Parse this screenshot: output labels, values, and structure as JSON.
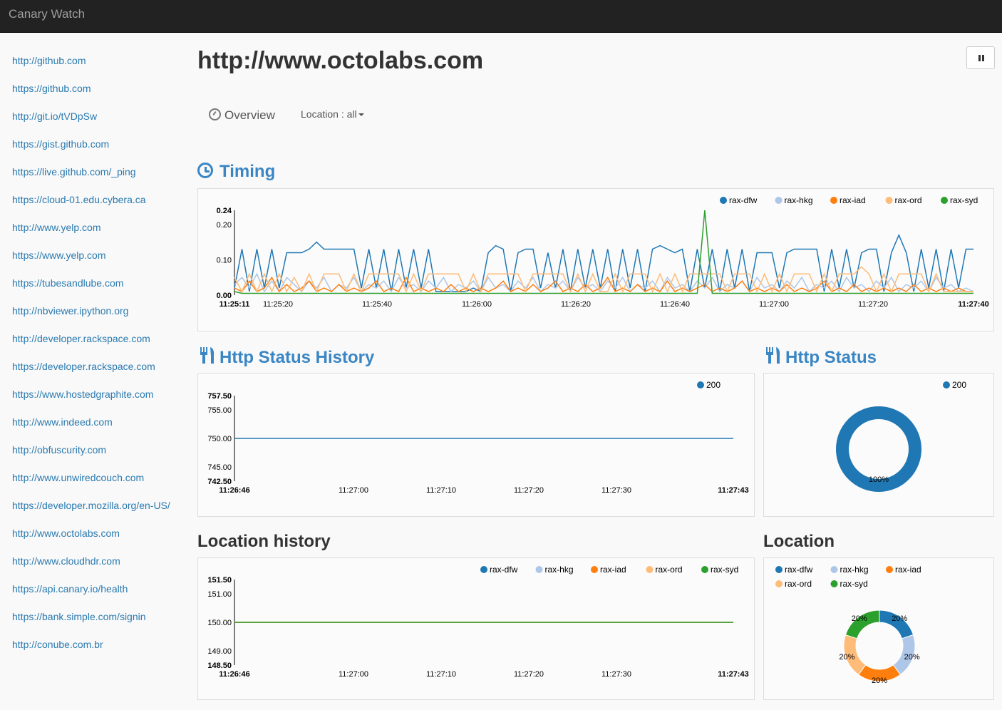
{
  "app": {
    "brand": "Canary Watch"
  },
  "sidebar": {
    "links": [
      "http://github.com",
      "https://github.com",
      "http://git.io/tVDpSw",
      "https://gist.github.com",
      "https://live.github.com/_ping",
      "https://cloud-01.edu.cybera.ca",
      "http://www.yelp.com",
      "https://www.yelp.com",
      "https://tubesandlube.com",
      "http://nbviewer.ipython.org",
      "http://developer.rackspace.com",
      "https://developer.rackspace.com",
      "https://www.hostedgraphite.com",
      "http://www.indeed.com",
      "http://obfuscurity.com",
      "http://www.unwiredcouch.com",
      "https://developer.mozilla.org/en-US/",
      "http://www.octolabs.com",
      "http://www.cloudhdr.com",
      "https://api.canary.io/health",
      "https://bank.simple.com/signin",
      "http://conube.com.br"
    ]
  },
  "page": {
    "title": "http://www.octolabs.com"
  },
  "tabs": {
    "overview": "Overview",
    "location": "Location : all"
  },
  "icons": {
    "pause": "pause-icon",
    "overview": "dashboard-icon",
    "timing": "clock-icon",
    "http": "cutlery-icon"
  },
  "sections": {
    "timing": "Timing",
    "http_status_history": "Http Status History",
    "http_status": "Http Status",
    "location_history": "Location history",
    "location": "Location"
  },
  "colors": {
    "rax-dfw": "#1f77b4",
    "rax-hkg": "#aec7e8",
    "rax-iad": "#ff7f0e",
    "rax-ord": "#ffbb78",
    "rax-syd": "#2ca02c",
    "accent": "#3a86c4"
  },
  "chart_data": [
    {
      "type": "line",
      "title": "Timing",
      "ylim": [
        0,
        0.24
      ],
      "yticks": [
        "0.00",
        "0.10",
        "0.20",
        "0.24"
      ],
      "xticks": [
        "11:25:11",
        "11:25:20",
        "11:25:40",
        "11:26:00",
        "11:26:20",
        "11:26:40",
        "11:27:00",
        "11:27:20",
        "11:27:40"
      ],
      "legend": [
        "rax-dfw",
        "rax-hkg",
        "rax-iad",
        "rax-ord",
        "rax-syd"
      ],
      "legend_position": "top-right",
      "series": [
        {
          "name": "rax-dfw",
          "y": [
            0.02,
            0.13,
            0.01,
            0.13,
            0.02,
            0.13,
            0.02,
            0.12,
            0.12,
            0.12,
            0.13,
            0.15,
            0.13,
            0.13,
            0.13,
            0.13,
            0.13,
            0.02,
            0.13,
            0.02,
            0.13,
            0.01,
            0.13,
            0.02,
            0.13,
            0.02,
            0.13,
            0.01,
            0.01,
            0.01,
            0.01,
            0.01,
            0.02,
            0.01,
            0.12,
            0.14,
            0.13,
            0.01,
            0.12,
            0.13,
            0.13,
            0.02,
            0.12,
            0.02,
            0.13,
            0.01,
            0.13,
            0.02,
            0.13,
            0.02,
            0.13,
            0.01,
            0.13,
            0.02,
            0.13,
            0.01,
            0.13,
            0.14,
            0.13,
            0.12,
            0.13,
            0.01,
            0.13,
            0.02,
            0.13,
            0.01,
            0.13,
            0.02,
            0.13,
            0.01,
            0.12,
            0.12,
            0.12,
            0.02,
            0.12,
            0.13,
            0.13,
            0.13,
            0.13,
            0.01,
            0.13,
            0.02,
            0.13,
            0.02,
            0.12,
            0.13,
            0.13,
            0.01,
            0.12,
            0.17,
            0.12,
            0.01,
            0.13,
            0.02,
            0.13,
            0.01,
            0.13,
            0.02,
            0.13,
            0.13
          ]
        },
        {
          "name": "rax-hkg",
          "y": [
            0.03,
            0.05,
            0.02,
            0.06,
            0.01,
            0.04,
            0.01,
            0.05,
            0.03,
            0.01,
            0.04,
            0.02,
            0.05,
            0.01,
            0.03,
            0.02,
            0.05,
            0.01,
            0.03,
            0.02,
            0.04,
            0.01,
            0.05,
            0.02,
            0.03,
            0.01,
            0.04,
            0.02,
            0.05,
            0.01,
            0.03,
            0.02,
            0.04,
            0.01,
            0.05,
            0.02,
            0.03,
            0.01,
            0.04,
            0.02,
            0.05,
            0.01,
            0.03,
            0.02,
            0.04,
            0.01,
            0.05,
            0.02,
            0.03,
            0.01,
            0.04,
            0.02,
            0.05,
            0.01,
            0.03,
            0.02,
            0.04,
            0.01,
            0.05,
            0.02,
            0.03,
            0.01,
            0.04,
            0.02,
            0.05,
            0.01,
            0.03,
            0.02,
            0.04,
            0.01,
            0.05,
            0.02,
            0.03,
            0.01,
            0.04,
            0.02,
            0.05,
            0.01,
            0.03,
            0.02,
            0.04,
            0.01,
            0.05,
            0.02,
            0.03,
            0.01,
            0.04,
            0.02,
            0.05,
            0.01,
            0.03,
            0.02,
            0.04,
            0.01,
            0.05,
            0.02,
            0.03,
            0.01,
            0.02,
            0.01
          ]
        },
        {
          "name": "rax-iad",
          "y": [
            0.02,
            0.01,
            0.04,
            0.01,
            0.02,
            0.05,
            0.01,
            0.03,
            0.01,
            0.02,
            0.04,
            0.01,
            0.02,
            0.01,
            0.03,
            0.01,
            0.02,
            0.01,
            0.02,
            0.04,
            0.01,
            0.02,
            0.01,
            0.05,
            0.01,
            0.02,
            0.01,
            0.02,
            0.01,
            0.03,
            0.01,
            0.02,
            0.01,
            0.02,
            0.01,
            0.02,
            0.04,
            0.01,
            0.02,
            0.01,
            0.03,
            0.01,
            0.02,
            0.04,
            0.01,
            0.02,
            0.01,
            0.03,
            0.01,
            0.02,
            0.05,
            0.01,
            0.02,
            0.01,
            0.03,
            0.01,
            0.02,
            0.01,
            0.04,
            0.01,
            0.02,
            0.01,
            0.02,
            0.03,
            0.01,
            0.02,
            0.01,
            0.02,
            0.04,
            0.01,
            0.02,
            0.01,
            0.02,
            0.01,
            0.03,
            0.01,
            0.02,
            0.01,
            0.02,
            0.04,
            0.01,
            0.02,
            0.01,
            0.03,
            0.01,
            0.02,
            0.01,
            0.02,
            0.01,
            0.02,
            0.01,
            0.03,
            0.01,
            0.02,
            0.01,
            0.02,
            0.01,
            0.02,
            0.01,
            0.01
          ]
        },
        {
          "name": "rax-ord",
          "y": [
            0.05,
            0.01,
            0.06,
            0.01,
            0.06,
            0.01,
            0.06,
            0.01,
            0.05,
            0.01,
            0.06,
            0.01,
            0.06,
            0.06,
            0.06,
            0.01,
            0.06,
            0.01,
            0.06,
            0.06,
            0.06,
            0.06,
            0.06,
            0.01,
            0.06,
            0.01,
            0.06,
            0.06,
            0.06,
            0.06,
            0.06,
            0.01,
            0.06,
            0.01,
            0.06,
            0.06,
            0.06,
            0.06,
            0.06,
            0.01,
            0.06,
            0.06,
            0.06,
            0.06,
            0.06,
            0.01,
            0.06,
            0.01,
            0.06,
            0.01,
            0.01,
            0.06,
            0.01,
            0.06,
            0.06,
            0.06,
            0.01,
            0.06,
            0.01,
            0.06,
            0.01,
            0.06,
            0.06,
            0.06,
            0.06,
            0.06,
            0.01,
            0.06,
            0.06,
            0.06,
            0.01,
            0.06,
            0.01,
            0.06,
            0.01,
            0.06,
            0.06,
            0.06,
            0.01,
            0.06,
            0.01,
            0.06,
            0.06,
            0.06,
            0.08,
            0.06,
            0.01,
            0.06,
            0.01,
            0.06,
            0.06,
            0.06,
            0.06,
            0.01,
            0.06,
            0.01,
            0.01,
            0.01,
            0.01,
            0.01
          ]
        },
        {
          "name": "rax-syd",
          "y": [
            0.01,
            0.005,
            0.005,
            0.005,
            0.005,
            0.005,
            0.005,
            0.005,
            0.005,
            0.005,
            0.005,
            0.005,
            0.005,
            0.005,
            0.005,
            0.005,
            0.005,
            0.005,
            0.005,
            0.005,
            0.005,
            0.005,
            0.005,
            0.005,
            0.005,
            0.005,
            0.005,
            0.005,
            0.005,
            0.005,
            0.005,
            0.005,
            0.005,
            0.005,
            0.005,
            0.005,
            0.005,
            0.005,
            0.005,
            0.005,
            0.005,
            0.005,
            0.005,
            0.005,
            0.005,
            0.005,
            0.005,
            0.005,
            0.005,
            0.005,
            0.005,
            0.005,
            0.005,
            0.005,
            0.005,
            0.005,
            0.005,
            0.005,
            0.005,
            0.005,
            0.005,
            0.005,
            0.005,
            0.24,
            0.005,
            0.005,
            0.005,
            0.005,
            0.005,
            0.005,
            0.005,
            0.005,
            0.005,
            0.005,
            0.005,
            0.005,
            0.005,
            0.005,
            0.005,
            0.005,
            0.005,
            0.005,
            0.005,
            0.005,
            0.005,
            0.005,
            0.005,
            0.005,
            0.005,
            0.005,
            0.005,
            0.005,
            0.005,
            0.005,
            0.005,
            0.005,
            0.005,
            0.005,
            0.005,
            0.005
          ]
        }
      ]
    },
    {
      "type": "line",
      "title": "Http Status History",
      "ylim": [
        742.5,
        757.5
      ],
      "yticks": [
        "742.50",
        "745.00",
        "750.00",
        "755.00",
        "757.50"
      ],
      "xticks": [
        "11:26:46",
        "11:27:00",
        "11:27:10",
        "11:27:20",
        "11:27:30",
        "11:27:43"
      ],
      "legend": [
        "200"
      ],
      "series": [
        {
          "name": "200",
          "y": [
            750,
            750
          ]
        }
      ]
    },
    {
      "type": "pie",
      "title": "Http Status",
      "legend": [
        "200"
      ],
      "slices": [
        {
          "label": "200",
          "value": 100,
          "text": "100%"
        }
      ]
    },
    {
      "type": "line",
      "title": "Location history",
      "ylim": [
        148.5,
        151.5
      ],
      "yticks": [
        "148.50",
        "149.00",
        "150.00",
        "151.00",
        "151.50"
      ],
      "xticks": [
        "11:26:46",
        "11:27:00",
        "11:27:10",
        "11:27:20",
        "11:27:30",
        "11:27:43"
      ],
      "legend": [
        "rax-dfw",
        "rax-hkg",
        "rax-iad",
        "rax-ord",
        "rax-syd"
      ],
      "series": [
        {
          "name": "rax-dfw",
          "y": [
            150,
            150
          ]
        },
        {
          "name": "rax-hkg",
          "y": [
            150,
            150
          ]
        },
        {
          "name": "rax-iad",
          "y": [
            150,
            150
          ]
        },
        {
          "name": "rax-ord",
          "y": [
            150,
            150
          ]
        },
        {
          "name": "rax-syd",
          "y": [
            150,
            150
          ]
        }
      ]
    },
    {
      "type": "pie",
      "title": "Location",
      "legend": [
        "rax-dfw",
        "rax-hkg",
        "rax-iad",
        "rax-ord",
        "rax-syd"
      ],
      "slices": [
        {
          "label": "rax-dfw",
          "value": 20,
          "text": "20%"
        },
        {
          "label": "rax-hkg",
          "value": 20,
          "text": "20%"
        },
        {
          "label": "rax-iad",
          "value": 20,
          "text": "20%"
        },
        {
          "label": "rax-ord",
          "value": 20,
          "text": "20%"
        },
        {
          "label": "rax-syd",
          "value": 20,
          "text": "20%"
        }
      ]
    }
  ]
}
